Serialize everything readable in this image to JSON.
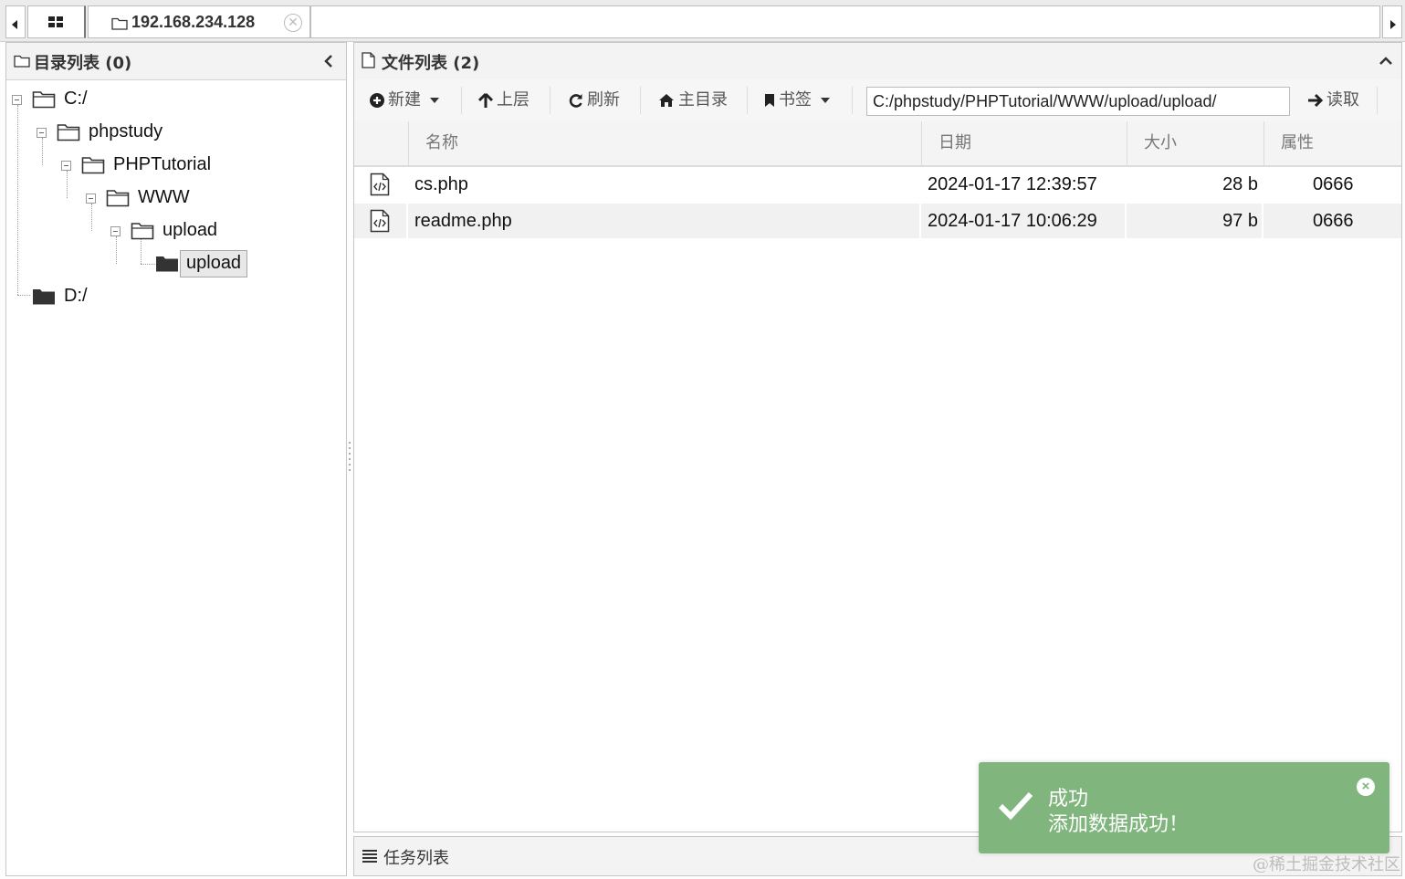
{
  "tabs": {
    "host": "192.168.234.128",
    "close_glyph": "✕"
  },
  "left_panel": {
    "title": "目录列表 (0)",
    "collapse_glyph": "‹",
    "tree": [
      {
        "label": "C:/",
        "icon": "folder-open-icon"
      },
      {
        "label": "phpstudy",
        "icon": "folder-open-icon"
      },
      {
        "label": "PHPTutorial",
        "icon": "folder-open-icon"
      },
      {
        "label": "WWW",
        "icon": "folder-open-icon"
      },
      {
        "label": "upload",
        "icon": "folder-open-icon"
      },
      {
        "label": "upload",
        "icon": "folder-closed-icon",
        "selected": true
      },
      {
        "label": "D:/",
        "icon": "folder-closed-icon"
      }
    ]
  },
  "right_panel": {
    "title": "文件列表 (2)",
    "toolbar": {
      "new_label": "新建",
      "up_label": "上层",
      "refresh_label": "刷新",
      "home_label": "主目录",
      "bookmark_label": "书签",
      "path_value": "C:/phpstudy/PHPTutorial/WWW/upload/upload/",
      "read_label": "读取"
    },
    "columns": [
      "名称",
      "日期",
      "大小",
      "属性"
    ],
    "rows": [
      {
        "name": "cs.php",
        "date": "2024-01-17 12:39:57",
        "size": "28 b",
        "attr": "0666"
      },
      {
        "name": "readme.php",
        "date": "2024-01-17 10:06:29",
        "size": "97 b",
        "attr": "0666"
      }
    ]
  },
  "task_bar": {
    "title": "任务列表"
  },
  "toast": {
    "title": "成功",
    "message": "添加数据成功！",
    "close_glyph": "×",
    "color": "#80b67e"
  },
  "watermark": "@稀土掘金技术社区"
}
